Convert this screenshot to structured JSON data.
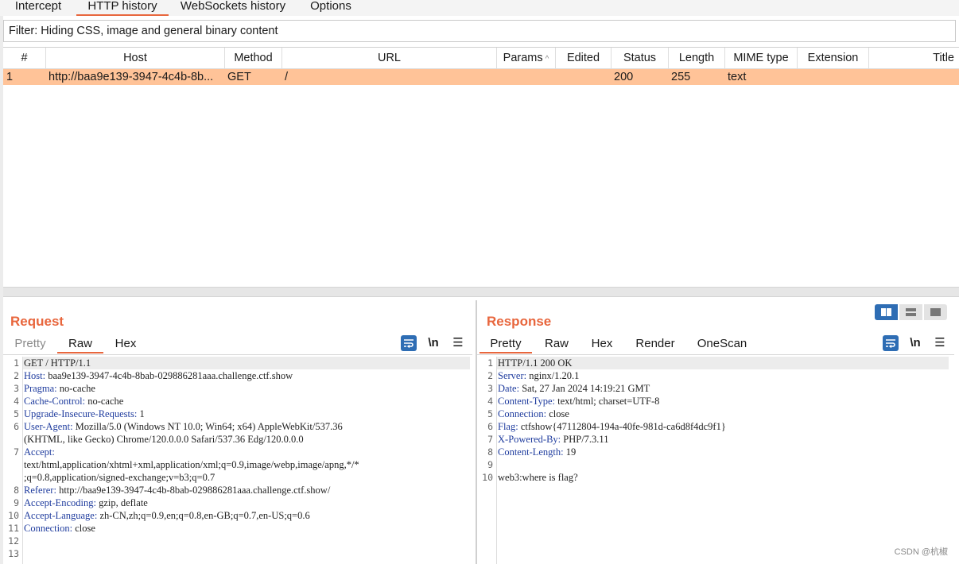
{
  "tabs": [
    {
      "label": "Intercept",
      "active": false
    },
    {
      "label": "HTTP history",
      "active": true
    },
    {
      "label": "WebSockets history",
      "active": false
    },
    {
      "label": "Options",
      "active": false
    }
  ],
  "filter": {
    "text": "Filter: Hiding CSS, image and general binary content"
  },
  "table": {
    "columns": [
      "#",
      "Host",
      "Method",
      "URL",
      "Params",
      "Edited",
      "Status",
      "Length",
      "MIME type",
      "Extension",
      "Title"
    ],
    "rows": [
      {
        "num": "1",
        "host": "http://baa9e139-3947-4c4b-8b...",
        "method": "GET",
        "url": "/",
        "params": "",
        "edited": "",
        "status": "200",
        "length": "255",
        "mime": "text",
        "extension": "",
        "title": ""
      }
    ]
  },
  "request": {
    "title": "Request",
    "tabs": [
      "Pretty",
      "Raw",
      "Hex"
    ],
    "active_tab": "Raw",
    "tools": {
      "newline": "\\n",
      "menu": "☰"
    },
    "lines": [
      {
        "n": "1",
        "key": "",
        "val": "GET / HTTP/1.1"
      },
      {
        "n": "2",
        "key": "Host:",
        "val": " baa9e139-3947-4c4b-8bab-029886281aaa.challenge.ctf.show"
      },
      {
        "n": "3",
        "key": "Pragma:",
        "val": " no-cache"
      },
      {
        "n": "4",
        "key": "Cache-Control:",
        "val": " no-cache"
      },
      {
        "n": "5",
        "key": "Upgrade-Insecure-Requests:",
        "val": " 1"
      },
      {
        "n": "6",
        "key": "User-Agent:",
        "val": " Mozilla/5.0 (Windows NT 10.0; Win64; x64) AppleWebKit/537.36"
      },
      {
        "n": "",
        "key": "",
        "val": "(KHTML, like Gecko) Chrome/120.0.0.0 Safari/537.36 Edg/120.0.0.0"
      },
      {
        "n": "7",
        "key": "Accept:",
        "val": ""
      },
      {
        "n": "",
        "key": "",
        "val": "text/html,application/xhtml+xml,application/xml;q=0.9,image/webp,image/apng,*/*"
      },
      {
        "n": "",
        "key": "",
        "val": ";q=0.8,application/signed-exchange;v=b3;q=0.7"
      },
      {
        "n": "8",
        "key": "Referer:",
        "val": " http://baa9e139-3947-4c4b-8bab-029886281aaa.challenge.ctf.show/"
      },
      {
        "n": "9",
        "key": "Accept-Encoding:",
        "val": " gzip, deflate"
      },
      {
        "n": "10",
        "key": "Accept-Language:",
        "val": " zh-CN,zh;q=0.9,en;q=0.8,en-GB;q=0.7,en-US;q=0.6"
      },
      {
        "n": "11",
        "key": "Connection:",
        "val": " close"
      },
      {
        "n": "12",
        "key": "",
        "val": ""
      },
      {
        "n": "13",
        "key": "",
        "val": ""
      }
    ]
  },
  "response": {
    "title": "Response",
    "tabs": [
      "Pretty",
      "Raw",
      "Hex",
      "Render",
      "OneScan"
    ],
    "active_tab": "Pretty",
    "tools": {
      "newline": "\\n",
      "menu": "☰"
    },
    "lines": [
      {
        "n": "1",
        "key": "",
        "val": "HTTP/1.1 200 OK"
      },
      {
        "n": "2",
        "key": "Server:",
        "val": " nginx/1.20.1"
      },
      {
        "n": "3",
        "key": "Date:",
        "val": " Sat, 27 Jan 2024 14:19:21 GMT"
      },
      {
        "n": "4",
        "key": "Content-Type:",
        "val": " text/html; charset=UTF-8"
      },
      {
        "n": "5",
        "key": "Connection:",
        "val": " close"
      },
      {
        "n": "6",
        "key": "Flag:",
        "val": " ctfshow{47112804-194a-40fe-981d-ca6d8f4dc9f1}"
      },
      {
        "n": "7",
        "key": "X-Powered-By:",
        "val": " PHP/7.3.11"
      },
      {
        "n": "8",
        "key": "Content-Length:",
        "val": " 19"
      },
      {
        "n": "9",
        "key": "",
        "val": ""
      },
      {
        "n": "10",
        "key": "",
        "val": "web3:where is flag?"
      }
    ]
  },
  "watermark": "CSDN @杭椒",
  "colors": {
    "accent": "#e8663d",
    "selected_row": "#ffc398",
    "header_key": "#1f3c9e",
    "tool_blue": "#2e6db4"
  }
}
